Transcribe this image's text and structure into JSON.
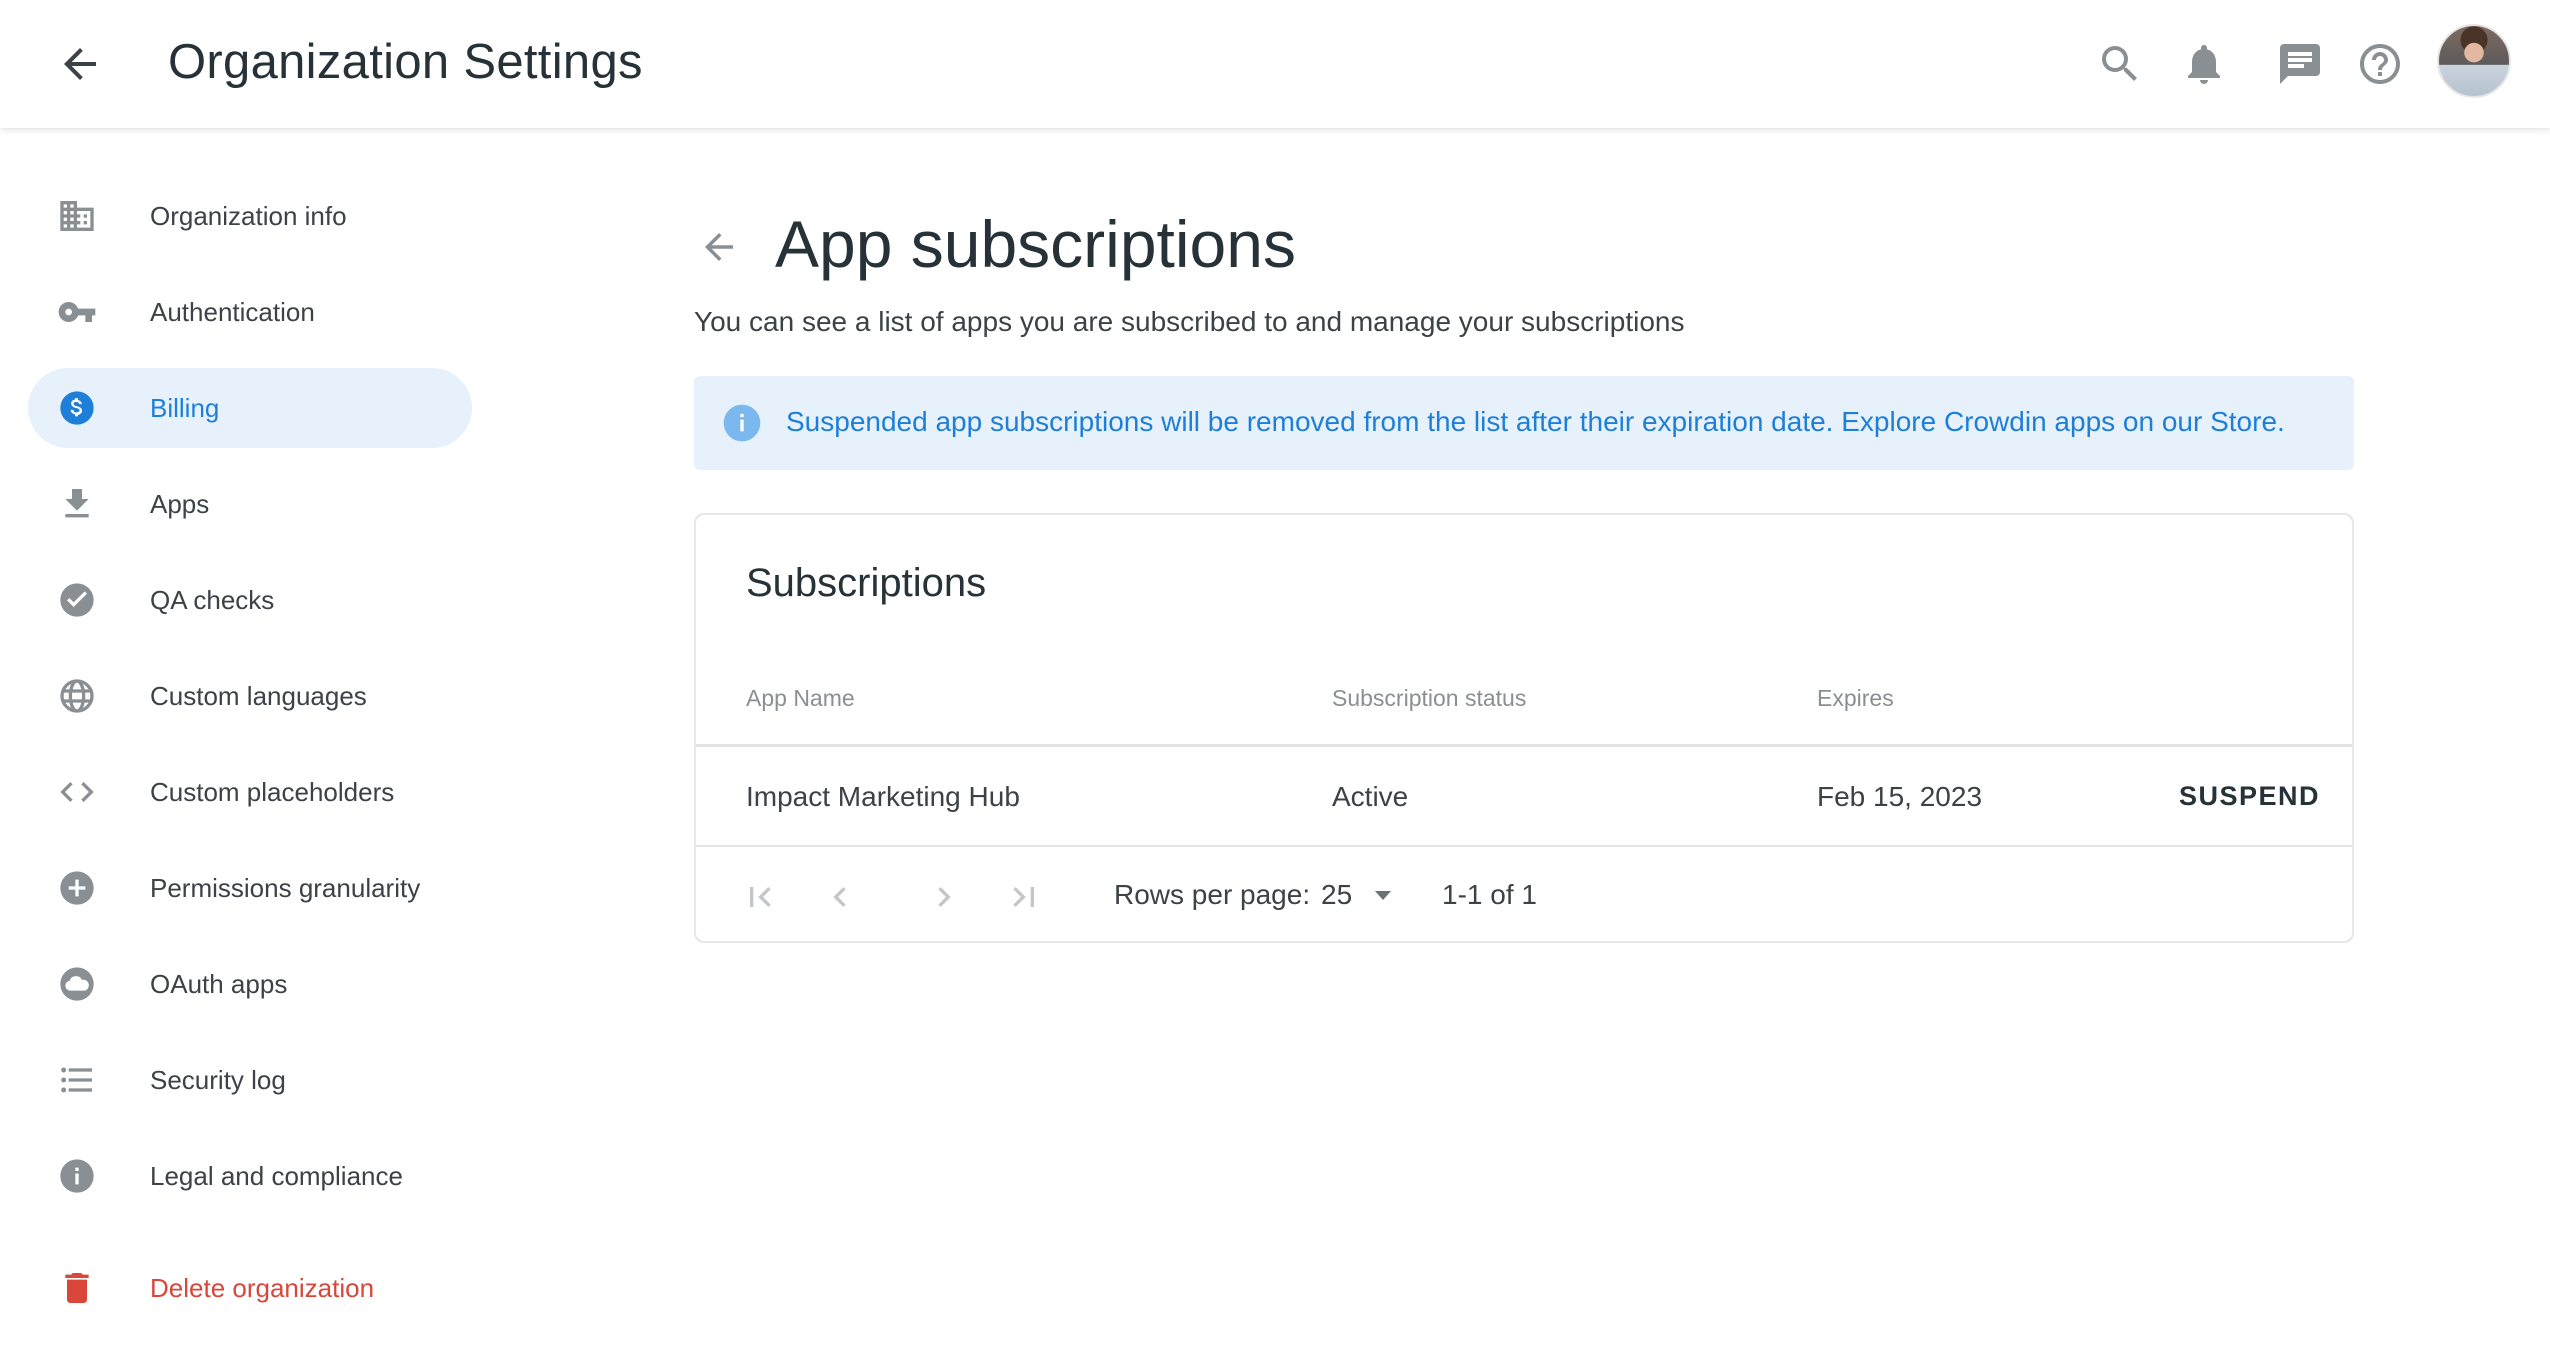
{
  "header": {
    "title": "Organization Settings",
    "icons": [
      "arrow-back-icon",
      "search-icon",
      "bell-icon",
      "chat-icon",
      "help-icon",
      "avatar"
    ]
  },
  "sidebar": {
    "items": [
      {
        "label": "Organization info",
        "icon": "building-icon",
        "active": false
      },
      {
        "label": "Authentication",
        "icon": "key-icon",
        "active": false
      },
      {
        "label": "Billing",
        "icon": "dollar-icon",
        "active": true
      },
      {
        "label": "Apps",
        "icon": "download-icon",
        "active": false
      },
      {
        "label": "QA checks",
        "icon": "check-circle-icon",
        "active": false
      },
      {
        "label": "Custom languages",
        "icon": "globe-icon",
        "active": false
      },
      {
        "label": "Custom placeholders",
        "icon": "code-icon",
        "active": false
      },
      {
        "label": "Permissions granularity",
        "icon": "plus-circle-icon",
        "active": false
      },
      {
        "label": "OAuth apps",
        "icon": "cloud-icon",
        "active": false
      },
      {
        "label": "Security log",
        "icon": "list-icon",
        "active": false
      },
      {
        "label": "Legal and compliance",
        "icon": "info-icon",
        "active": false
      },
      {
        "label": "Delete organization",
        "icon": "trash-icon",
        "active": false,
        "danger": true
      }
    ]
  },
  "main": {
    "title": "App subscriptions",
    "subtitle": "You can see a list of apps you are subscribed to and manage your subscriptions",
    "banner": {
      "icon": "info-icon",
      "text": "Suspended app subscriptions will be removed from the list after their expiration date. Explore Crowdin apps on our Store."
    },
    "card": {
      "title": "Subscriptions",
      "columns": [
        "App Name",
        "Subscription status",
        "Expires"
      ],
      "rows": [
        {
          "app_name": "Impact Marketing Hub",
          "status": "Active",
          "expires": "Feb 15, 2023",
          "action": "SUSPEND"
        }
      ],
      "pagination": {
        "rows_per_page_label": "Rows per page:",
        "rows_per_page": "25",
        "range": "1-1 of 1"
      }
    }
  },
  "colors": {
    "accent": "#1e7fd8",
    "active_bg": "#e6f1fc",
    "danger": "#d9473b",
    "icon_gray": "#8a8f93",
    "text": "#263238"
  }
}
